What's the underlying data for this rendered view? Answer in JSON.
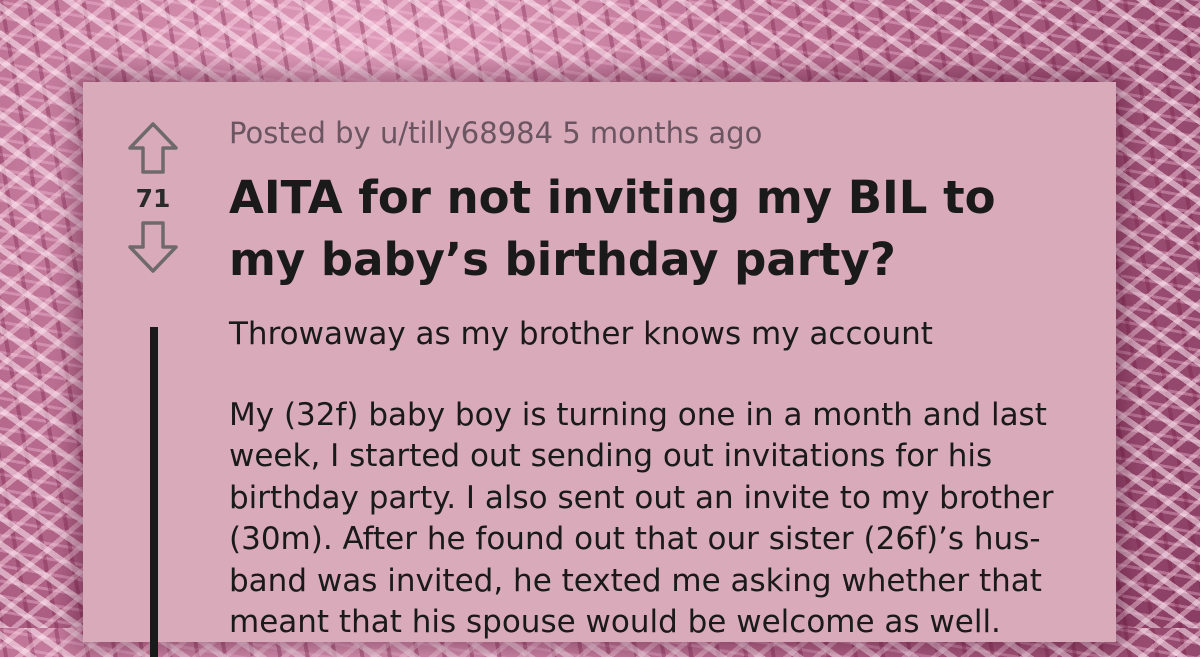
{
  "post": {
    "meta": {
      "prefix": "Posted by ",
      "username": "u/tilly68984",
      "age": " 5 months ago"
    },
    "score": "71",
    "title_lines": [
      "AITA for not inviting my BIL to",
      "my baby’s birthday party?"
    ],
    "subtitle": "Throwaway as my brother knows my account",
    "body_lines": [
      "My (32f) baby boy is turning one in a month and last",
      "week, I started out sending out invitations for his",
      "birthday party. I also sent out an invite to my brother",
      "(30m). After he found out that our sister (26f)’s hus-",
      "band was invited, he texted me asking whether that",
      "meant that his spouse would be welcome as well."
    ]
  },
  "icons": {
    "upvote": "upvote-arrow-icon",
    "downvote": "downvote-arrow-icon"
  },
  "colors": {
    "card_background": "#d9aab9",
    "text": "#1a1a1a",
    "meta_text": "#6b5560",
    "thread_line": "#1a1a1a"
  }
}
